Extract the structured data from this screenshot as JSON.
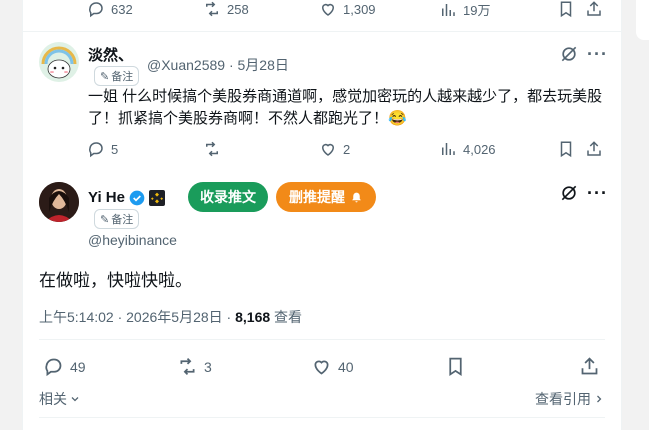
{
  "top_tweet_stats": {
    "replies": "632",
    "retweets": "258",
    "likes": "1,309",
    "views": "19万"
  },
  "reply": {
    "name": "淡然、",
    "note_label": "备注",
    "handle": "@Xuan2589",
    "separator": "·",
    "date": "5月28日",
    "text_line1": "一姐 什么时候搞个美股券商通道啊，感觉加密玩的人越来越少了，都去玩美股",
    "text_line2": "了！抓紧搞个美股券商啊！不然人都跑光了！😂",
    "stats": {
      "replies": "5",
      "retweets": "",
      "likes": "2",
      "views": "4,026"
    }
  },
  "main_tweet": {
    "name": "Yi He",
    "note_label": "备注",
    "handle": "@heyibinance",
    "collect_button": "收录推文",
    "delete_alert_button": "删推提醒",
    "text": "在做啦，快啦快啦。",
    "time": "上午5:14:02 · 2026年5月28日 · ",
    "views_count": "8,168",
    "views_label": " 查看",
    "stats": {
      "replies": "49",
      "retweets": "3",
      "likes": "40"
    }
  },
  "footer": {
    "related": "相关",
    "quotes": "查看引用"
  },
  "colors": {
    "green": "#1a9c5b",
    "orange": "#f28a18",
    "verified": "#1d9bf0",
    "gold": "#f0b90b"
  }
}
